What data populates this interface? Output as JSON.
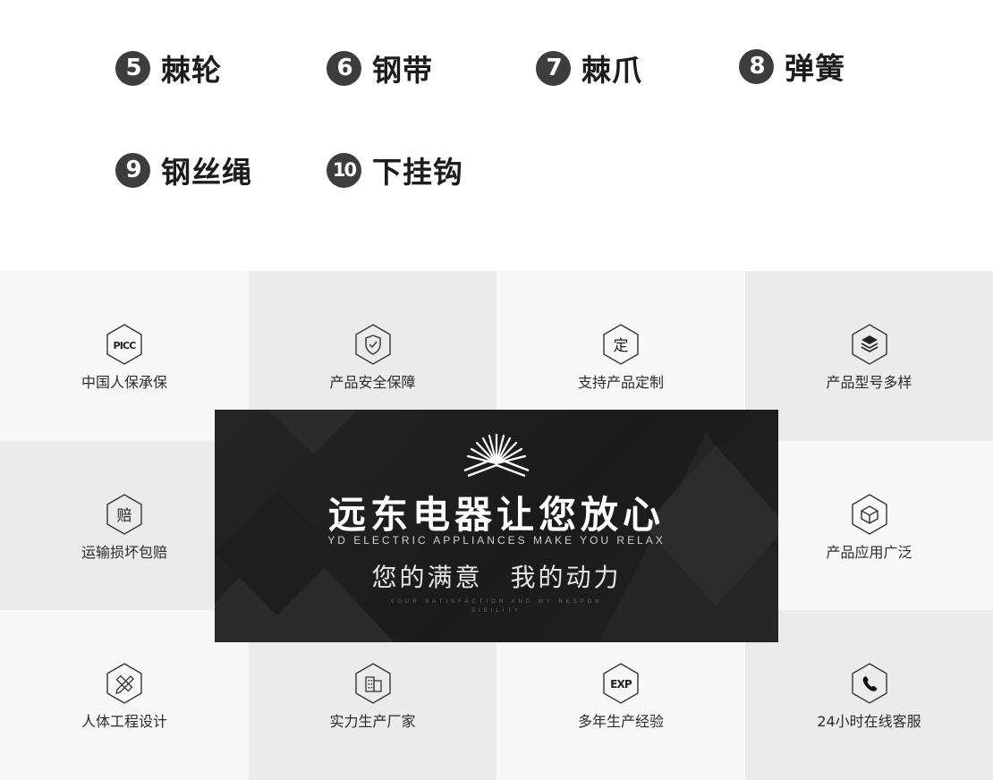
{
  "parts": [
    {
      "num": "5",
      "name": "棘轮"
    },
    {
      "num": "6",
      "name": "钢带"
    },
    {
      "num": "7",
      "name": "棘爪"
    },
    {
      "num": "8",
      "name": "弹簧"
    },
    {
      "num": "9",
      "name": "钢丝绳"
    },
    {
      "num": "10",
      "name": "下挂钩"
    }
  ],
  "features": [
    {
      "label": "中国人保承保",
      "icon": "picc-icon",
      "icon_text": "PICC"
    },
    {
      "label": "产品安全保障",
      "icon": "shield-check-icon"
    },
    {
      "label": "支持产品定制",
      "icon": "custom-icon",
      "icon_text": "定"
    },
    {
      "label": "产品型号多样",
      "icon": "layers-icon"
    },
    {
      "label": "运输损坏包赔",
      "icon": "compensation-icon",
      "icon_text": "赔"
    },
    {
      "label": "产品应用广泛",
      "icon": "cube-icon"
    },
    {
      "label": "人体工程设计",
      "icon": "pencil-ruler-icon"
    },
    {
      "label": "实力生产厂家",
      "icon": "building-icon"
    },
    {
      "label": "多年生产经验",
      "icon": "experience-icon",
      "icon_text": "EXP"
    },
    {
      "label": "24小时在线客服",
      "icon": "phone-icon"
    }
  ],
  "banner": {
    "title": "远东电器让您放心",
    "subtitle": "YD ELECTRIC APPLIANCES MAKE YOU RELAX",
    "slogan": "您的满意　我的动力",
    "tiny": "YOUR SATISFACTION AND MY RESPON SIBILITY"
  },
  "colors": {
    "badge": "#3d3d3d",
    "cell_light": "#f7f7f7",
    "cell_dark": "#ebebeb",
    "banner_bg": "#1f1f1f",
    "icon_stroke": "#333333"
  }
}
